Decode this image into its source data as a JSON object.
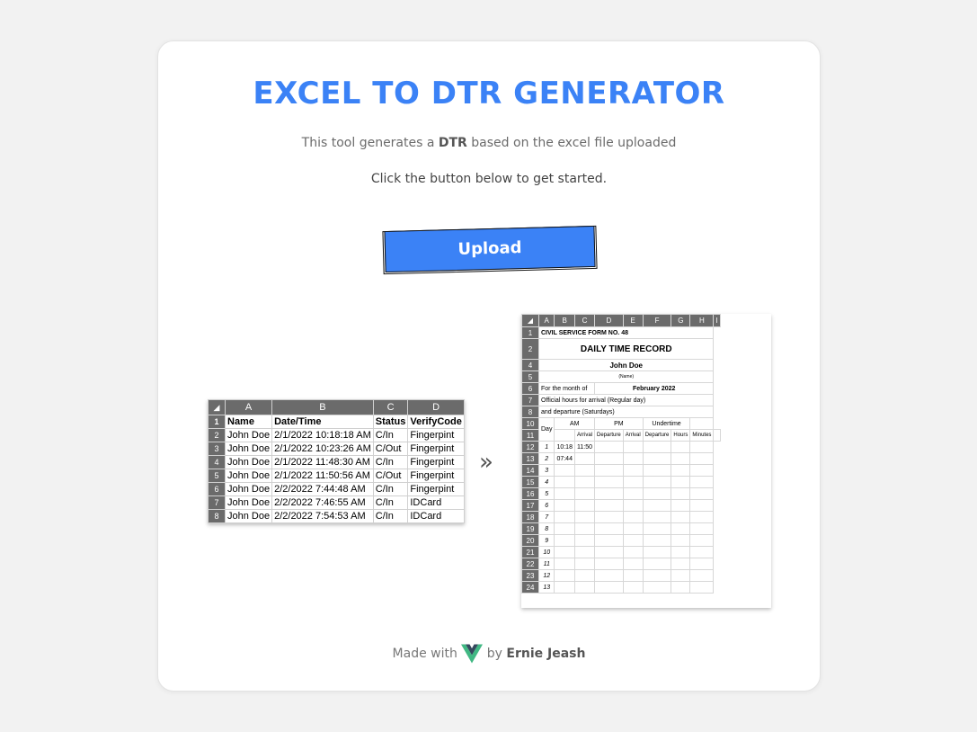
{
  "title": "EXCEL TO DTR GENERATOR",
  "description": {
    "prefix": "This tool generates a ",
    "bold": "DTR",
    "suffix": " based on the excel file uploaded"
  },
  "get_started": "Click the button below to get started.",
  "upload_label": "Upload",
  "arrow": "»",
  "input_sheet": {
    "columns": [
      "A",
      "B",
      "C",
      "D"
    ],
    "rows": [
      [
        "1",
        "Name",
        "Date/Time",
        "Status",
        "VerifyCode"
      ],
      [
        "2",
        "John Doe",
        "2/1/2022 10:18:18 AM",
        "C/In",
        "Fingerpint"
      ],
      [
        "3",
        "John Doe",
        "2/1/2022 10:23:26 AM",
        "C/Out",
        "Fingerpint"
      ],
      [
        "4",
        "John Doe",
        "2/1/2022 11:48:30 AM",
        "C/In",
        "Fingerpint"
      ],
      [
        "5",
        "John Doe",
        "2/1/2022 11:50:56 AM",
        "C/Out",
        "Fingerpint"
      ],
      [
        "6",
        "John Doe",
        "2/2/2022 7:44:48 AM",
        "C/In",
        "Fingerpint"
      ],
      [
        "7",
        "John Doe",
        "2/2/2022 7:46:55 AM",
        "C/In",
        "IDCard"
      ],
      [
        "8",
        "John Doe",
        "2/2/2022 7:54:53 AM",
        "C/In",
        "IDCard"
      ]
    ]
  },
  "dtr_sheet": {
    "columns": [
      "A",
      "B",
      "C",
      "D",
      "E",
      "F",
      "G",
      "H",
      "I"
    ],
    "form_no": "CIVIL SERVICE FORM NO. 48",
    "heading": "DAILY TIME RECORD",
    "name": "John Doe",
    "name_caption": "(Name)",
    "month_label": "For the month of",
    "month_value": "February 2022",
    "hours_regular": "Official hours for arrival (Regular day)",
    "hours_saturday": "and departure (Saturdays)",
    "day_label": "Day",
    "am_label": "AM",
    "pm_label": "PM",
    "undertime_label": "Undertime",
    "sub_headers": [
      "Arrival",
      "Departure",
      "Arrival",
      "Departure",
      "Hours",
      "Minutes"
    ],
    "days": [
      {
        "row": "12",
        "day": "1",
        "am_arrival": "10:18",
        "am_departure": "11:50"
      },
      {
        "row": "13",
        "day": "2",
        "am_arrival": "07:44",
        "am_departure": ""
      },
      {
        "row": "14",
        "day": "3",
        "am_arrival": "",
        "am_departure": ""
      },
      {
        "row": "15",
        "day": "4",
        "am_arrival": "",
        "am_departure": ""
      },
      {
        "row": "16",
        "day": "5",
        "am_arrival": "",
        "am_departure": ""
      },
      {
        "row": "17",
        "day": "6",
        "am_arrival": "",
        "am_departure": ""
      },
      {
        "row": "18",
        "day": "7",
        "am_arrival": "",
        "am_departure": ""
      },
      {
        "row": "19",
        "day": "8",
        "am_arrival": "",
        "am_departure": ""
      },
      {
        "row": "20",
        "day": "9",
        "am_arrival": "",
        "am_departure": ""
      },
      {
        "row": "21",
        "day": "10",
        "am_arrival": "",
        "am_departure": ""
      },
      {
        "row": "22",
        "day": "11",
        "am_arrival": "",
        "am_departure": ""
      },
      {
        "row": "23",
        "day": "12",
        "am_arrival": "",
        "am_departure": ""
      },
      {
        "row": "24",
        "day": "13",
        "am_arrival": "",
        "am_departure": ""
      }
    ]
  },
  "footer": {
    "made_with": "Made with",
    "by": "by",
    "author": "Ernie Jeash",
    "icon": "vue-logo-icon"
  },
  "colors": {
    "accent": "#3b82f6",
    "vue_green": "#41b883",
    "vue_dark": "#35495e"
  }
}
